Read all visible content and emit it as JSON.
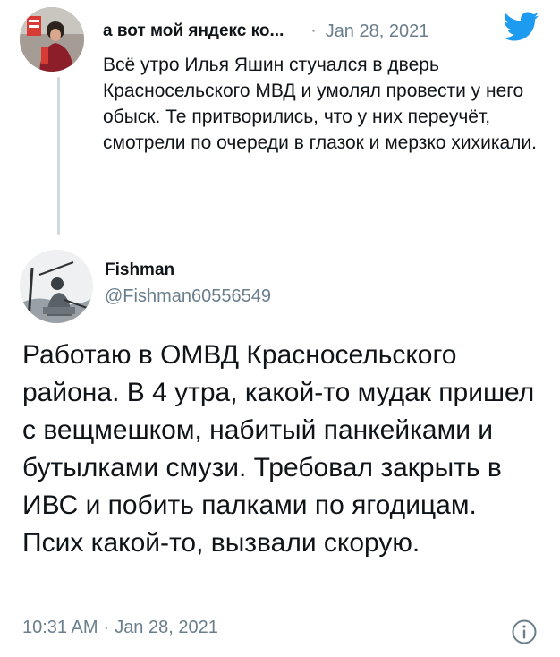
{
  "parent_tweet": {
    "author_name": "а вот мой яндекс ко...",
    "separator": "·",
    "date": "Jan 28, 2021",
    "avatar_icon": "profile-photo-avatar",
    "text": "Всё утро Илья Яшин стучался в дверь Красносельского МВД и умолял провести у него обыск. Те притворились, что у них переучёт, смотрели по очереди в глазок и мерзко хихикали."
  },
  "main_tweet": {
    "author_name": "Fishman",
    "handle": "@Fishman60556549",
    "avatar_icon": "profile-photo-avatar",
    "text": "Работаю в ОМВД Красносельского района. В 4 утра, какой-то мудак пришел с вещмешком, набитый панкейками и бутылками смузи. Требовал закрыть в ИВС и побить палками по ягодицам. Псих какой-то, вызвали скорую.",
    "time": "10:31 AM",
    "separator": "·",
    "date": "Jan 28, 2021"
  },
  "colors": {
    "text": "#0f1419",
    "secondary": "#6a7e8c",
    "twitter_blue": "#1d9bf0",
    "thread_line": "#cfd9de"
  }
}
